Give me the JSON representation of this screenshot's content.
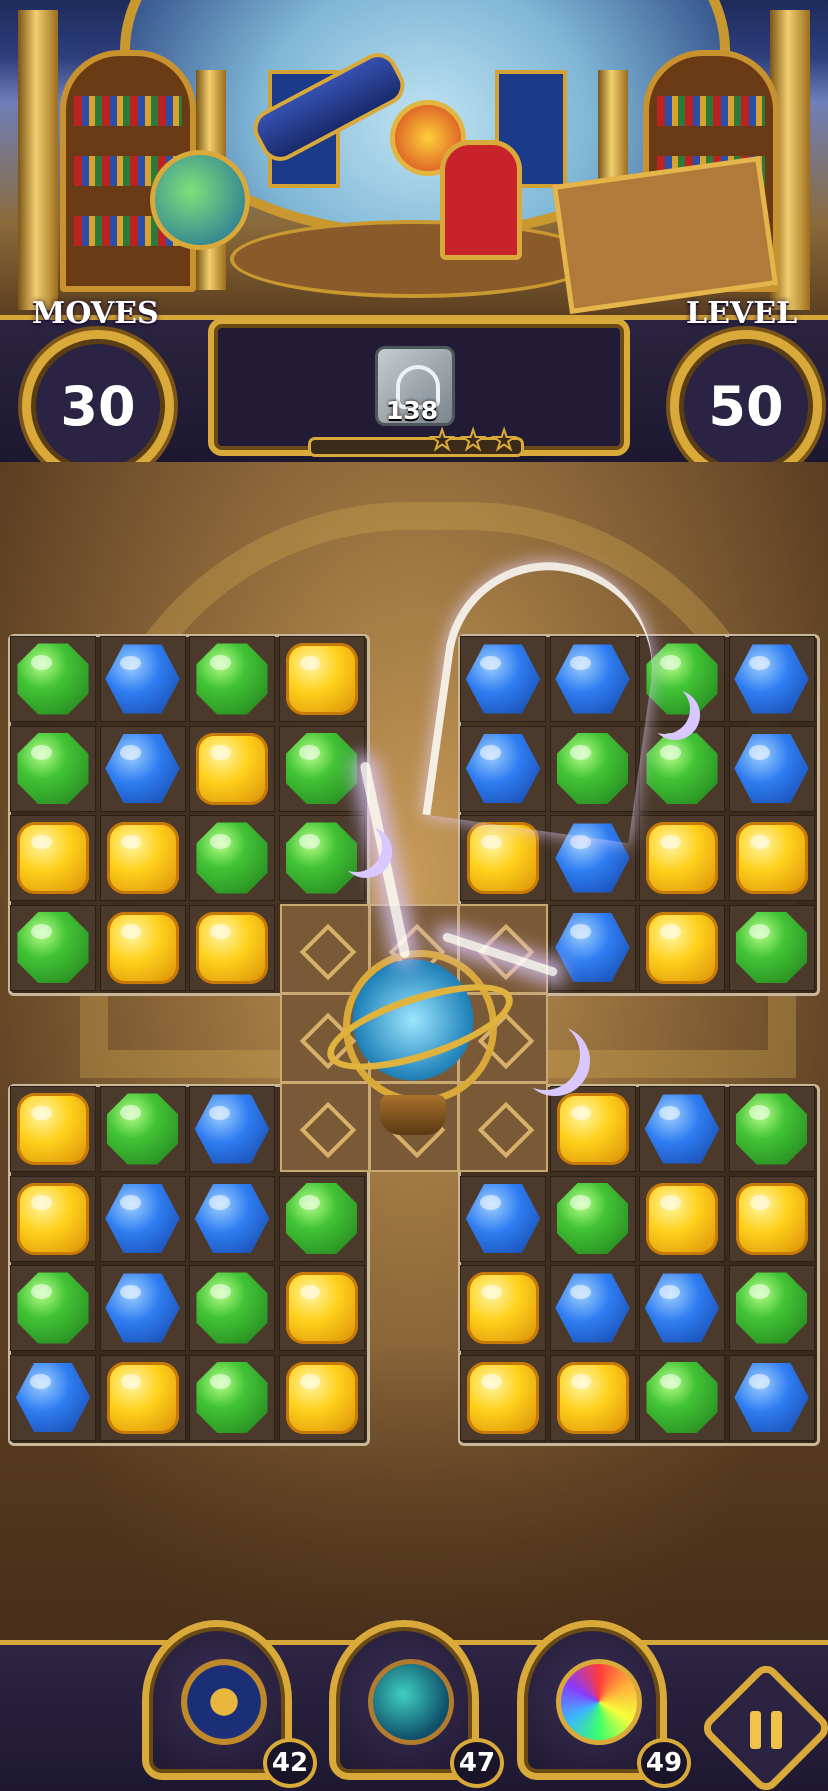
{
  "hud": {
    "moves_label": "MOVES",
    "moves_value": "30",
    "level_label": "LEVEL",
    "level_value": "50",
    "goal": {
      "icon": "stone-tile-icon",
      "count": "138"
    },
    "stars_total": 3,
    "stars_earned": 0,
    "progress": 0.0
  },
  "board": {
    "gem_colors": {
      "green": "#42c436",
      "blue": "#2f7df2",
      "yellow": "#ffd11c"
    },
    "top_left": [
      [
        "green",
        "blue",
        "green",
        "yellow"
      ],
      [
        "green",
        "blue",
        "yellow",
        "green"
      ],
      [
        "yellow",
        "yellow",
        "green",
        "green"
      ],
      [
        "green",
        "yellow",
        "yellow",
        null
      ]
    ],
    "top_right": [
      [
        "blue",
        "blue",
        "green",
        "blue"
      ],
      [
        "blue",
        "green",
        "green",
        "blue"
      ],
      [
        "yellow",
        "blue",
        "yellow",
        "yellow"
      ],
      [
        null,
        "blue",
        "yellow",
        "green"
      ]
    ],
    "bottom_left": [
      [
        "yellow",
        "green",
        "blue",
        null
      ],
      [
        "yellow",
        "blue",
        "blue",
        "green"
      ],
      [
        "green",
        "blue",
        "green",
        "yellow"
      ],
      [
        "blue",
        "yellow",
        "green",
        "yellow"
      ]
    ],
    "bottom_right": [
      [
        null,
        "yellow",
        "blue",
        "green"
      ],
      [
        "blue",
        "green",
        "yellow",
        "yellow"
      ],
      [
        "yellow",
        "blue",
        "blue",
        "green"
      ],
      [
        "yellow",
        "yellow",
        "green",
        "blue"
      ]
    ],
    "center_object": "armillary-sphere-icon",
    "effects": [
      "crescent-moon-icon",
      "crescent-moon-icon",
      "crescent-moon-icon"
    ]
  },
  "boosters": [
    {
      "name": "telescope-cannon-icon",
      "count": "42"
    },
    {
      "name": "caged-orb-icon",
      "count": "47"
    },
    {
      "name": "rainbow-compass-icon",
      "count": "49"
    }
  ],
  "pause_icon": "pause-icon"
}
